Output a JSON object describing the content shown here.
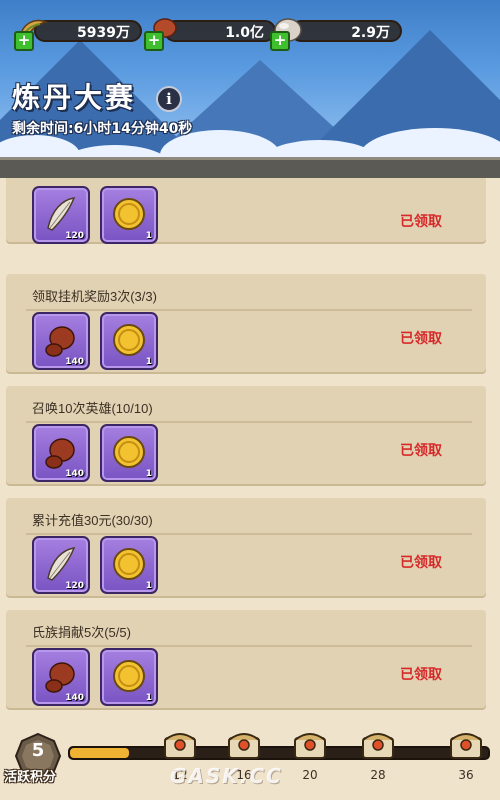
{
  "resources": [
    {
      "icon": "wing-icon",
      "value": "5939万"
    },
    {
      "icon": "meat-icon",
      "value": "1.0亿"
    },
    {
      "icon": "stone-icon",
      "value": "2.9万"
    }
  ],
  "header": {
    "title": "炼丹大赛",
    "info_symbol": "i",
    "timer": "剩余时间:6小时14分钟40秒"
  },
  "tasks": [
    {
      "label": "",
      "rewards": [
        {
          "icon": "feather-icon",
          "count": "120"
        },
        {
          "icon": "gold-coin-icon",
          "count": "1"
        }
      ],
      "status": "已领取"
    },
    {
      "label": "领取挂机奖励3次(3/3)",
      "rewards": [
        {
          "icon": "meat-icon",
          "count": "140"
        },
        {
          "icon": "gold-coin-icon",
          "count": "1"
        }
      ],
      "status": "已领取"
    },
    {
      "label": "召唤10次英雄(10/10)",
      "rewards": [
        {
          "icon": "meat-icon",
          "count": "140"
        },
        {
          "icon": "gold-coin-icon",
          "count": "1"
        }
      ],
      "status": "已领取"
    },
    {
      "label": "累计充值30元(30/30)",
      "rewards": [
        {
          "icon": "feather-icon",
          "count": "120"
        },
        {
          "icon": "gold-coin-icon",
          "count": "1"
        }
      ],
      "status": "已领取"
    },
    {
      "label": "氏族捐献5次(5/5)",
      "rewards": [
        {
          "icon": "meat-icon",
          "count": "140"
        },
        {
          "icon": "gold-coin-icon",
          "count": "1"
        }
      ],
      "status": "已领取"
    }
  ],
  "activity": {
    "points": "5",
    "label": "活跃积分",
    "progress": 0.14,
    "milestones": [
      "12",
      "16",
      "20",
      "28",
      "36"
    ],
    "watermark": "GASK.CC"
  },
  "colors": {
    "status": "#d62a2a",
    "item_bg": "#8a62d0",
    "bar_fill": "#f0b232"
  }
}
